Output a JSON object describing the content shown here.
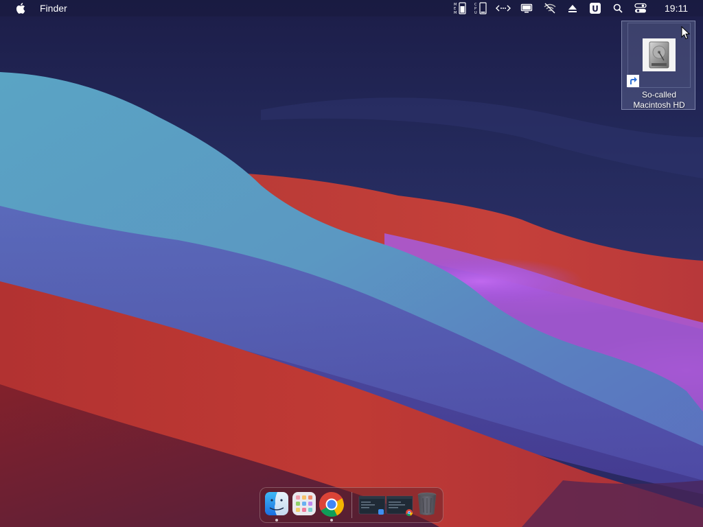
{
  "menubar": {
    "app_name": "Finder",
    "clock": "19:11",
    "status_items": [
      {
        "name": "memory-monitor-icon"
      },
      {
        "name": "cpu-monitor-icon"
      },
      {
        "name": "network-activity-icon"
      },
      {
        "name": "display-icon"
      },
      {
        "name": "wifi-off-icon"
      },
      {
        "name": "eject-icon"
      },
      {
        "name": "u-app-icon"
      },
      {
        "name": "search-icon"
      },
      {
        "name": "control-center-icon"
      }
    ]
  },
  "desktop": {
    "icons": [
      {
        "label": "So-called Macintosh HD",
        "kind": "shortcut",
        "icon": "hard-drive-icon"
      }
    ]
  },
  "dock": {
    "apps": [
      {
        "name": "Finder",
        "icon": "finder-icon",
        "running": true
      },
      {
        "name": "Launchpad",
        "icon": "launchpad-icon",
        "running": false
      },
      {
        "name": "Google Chrome",
        "icon": "chrome-icon",
        "running": true
      }
    ],
    "minimized": [
      {
        "name": "minimized-finder-window",
        "icon": "finder-window-thumbnail"
      },
      {
        "name": "minimized-chrome-window",
        "icon": "chrome-window-thumbnail"
      }
    ],
    "trash": {
      "name": "Trash",
      "icon": "trash-icon"
    }
  },
  "colors": {
    "wave_red": "#c53a32",
    "wave_blue": "#5a9fc0",
    "wave_purple": "#a55ad8",
    "sky": "#1f2150"
  }
}
